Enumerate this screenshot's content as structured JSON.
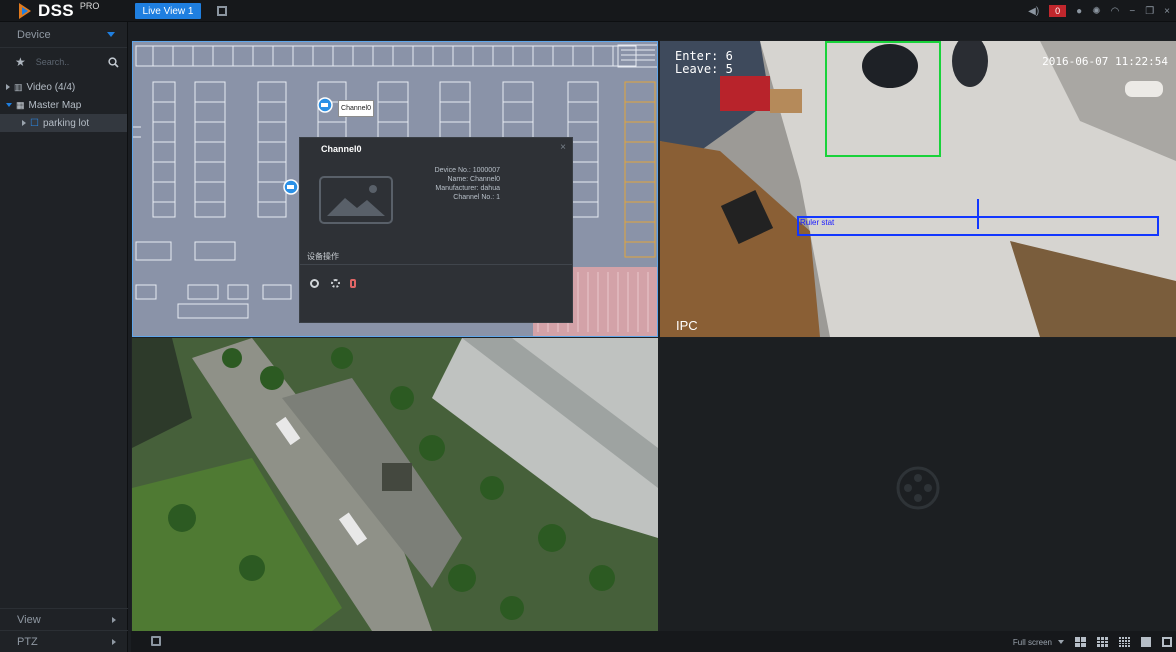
{
  "app": {
    "brand": "DSS",
    "brand_suffix": "PRO"
  },
  "tabs": [
    {
      "label": "Live View 1"
    }
  ],
  "tray": {
    "alarm_count": "0"
  },
  "sidebar": {
    "dropdown_label": "Device",
    "search_placeholder": "Search..",
    "tree": [
      {
        "label": "Video (4/4)"
      },
      {
        "label": "Master Map"
      },
      {
        "label": "parking lot"
      }
    ],
    "bottom": [
      {
        "label": "View"
      },
      {
        "label": "PTZ"
      }
    ]
  },
  "map_popup": {
    "title": "Channel0",
    "tooltip": "Channel0",
    "info": [
      "Device No.: 1000007",
      "Name: Channel0",
      "Manufacturer: dahua",
      "Channel No.: 1"
    ],
    "ops_label": "设备操作"
  },
  "camera": {
    "enter": "Enter: 6",
    "leave": "Leave: 5",
    "timestamp": "2016-06-07 11:22:54",
    "channel_label": "IPC",
    "rule_label": "Ruler stat"
  },
  "bottombar": {
    "fullscreen": "Full screen"
  },
  "colors": {
    "accent": "#1f7fe0",
    "alarm": "#c1272d",
    "map_selection": "#5fa6ea",
    "ivs_box": "#19d23a",
    "tripwire": "#1237ff"
  }
}
